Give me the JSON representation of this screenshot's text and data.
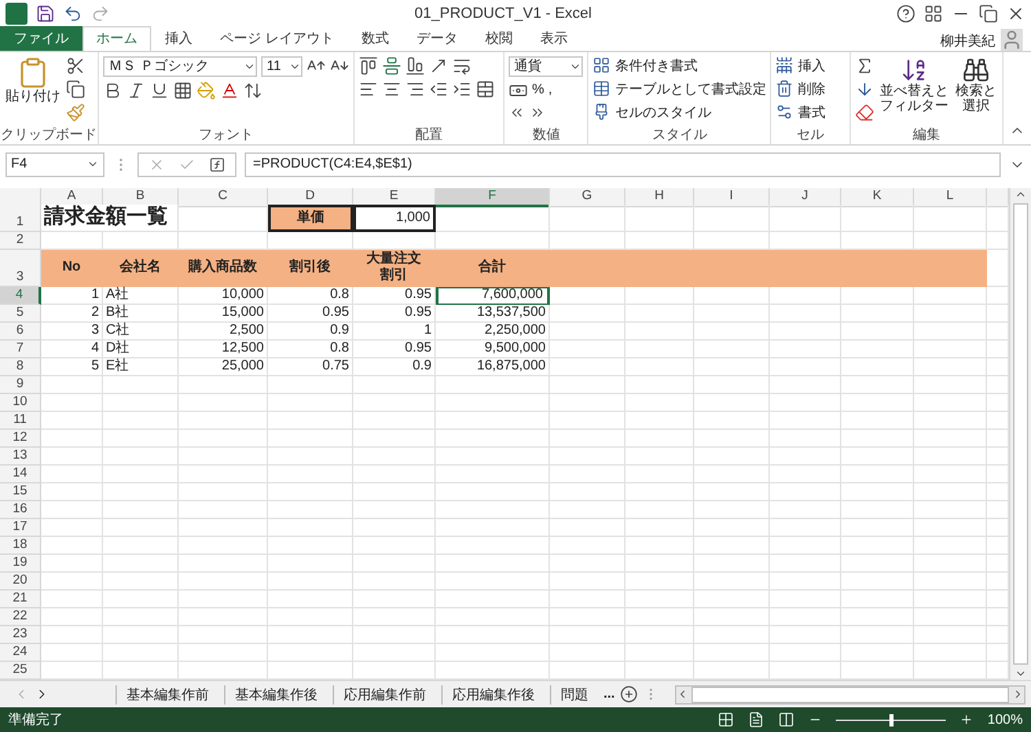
{
  "title_bar": {
    "title": "01_PRODUCT_V1 - Excel",
    "user": "柳井美紀"
  },
  "tabs": [
    {
      "label": "ファイル",
      "kind": "file",
      "selected": false
    },
    {
      "label": "ホーム",
      "kind": "tab",
      "selected": true
    },
    {
      "label": "挿入",
      "kind": "tab",
      "selected": false
    },
    {
      "label": "ページ レイアウト",
      "kind": "tab",
      "selected": false
    },
    {
      "label": "数式",
      "kind": "tab",
      "selected": false
    },
    {
      "label": "データ",
      "kind": "tab",
      "selected": false
    },
    {
      "label": "校閲",
      "kind": "tab",
      "selected": false
    },
    {
      "label": "表示",
      "kind": "tab",
      "selected": false
    }
  ],
  "ribbon": {
    "clipboard": {
      "label": "クリップボード",
      "paste": "貼り付け"
    },
    "font": {
      "label": "フォント",
      "name": "ＭＳ Ｐゴシック",
      "size": "11"
    },
    "alignment": {
      "label": "配置"
    },
    "number": {
      "label": "数値",
      "format": "通貨",
      "percent": "%",
      "comma": ","
    },
    "styles": {
      "label": "スタイル",
      "items": [
        "条件付き書式",
        "テーブルとして書式設定",
        "セルのスタイル"
      ]
    },
    "cells": {
      "label": "セル",
      "items": [
        "挿入",
        "削除",
        "書式"
      ]
    },
    "editing": {
      "label": "編集",
      "sort": "並べ替えとフィルター",
      "find": "検索と選択"
    }
  },
  "formula_bar": {
    "name_box": "F4",
    "formula": "=PRODUCT(C4:E4,$E$1)"
  },
  "sheet": {
    "columns": [
      {
        "label": "A",
        "selected": false
      },
      {
        "label": "B",
        "selected": false
      },
      {
        "label": "C",
        "selected": false
      },
      {
        "label": "D",
        "selected": false
      },
      {
        "label": "E",
        "selected": false
      },
      {
        "label": "F",
        "selected": true
      },
      {
        "label": "G",
        "selected": false
      },
      {
        "label": "H",
        "selected": false
      },
      {
        "label": "I",
        "selected": false
      },
      {
        "label": "J",
        "selected": false
      },
      {
        "label": "K",
        "selected": false
      },
      {
        "label": "L",
        "selected": false
      }
    ],
    "rows": [
      {
        "header": "1",
        "kind": "title",
        "selected": false,
        "cells": [
          "請求金額一覧",
          "",
          "",
          "単価",
          "1,000",
          ""
        ]
      },
      {
        "header": "2",
        "kind": "blank",
        "selected": false
      },
      {
        "header": "3",
        "kind": "header",
        "selected": false,
        "cells": [
          "No",
          "会社名",
          "購入商品数",
          "割引後",
          "大量注文割引",
          "合計"
        ]
      },
      {
        "header": "4",
        "kind": "data",
        "selected": true,
        "cells": [
          "1",
          "A社",
          "10,000",
          "0.8",
          "0.95",
          "7,600,000"
        ]
      },
      {
        "header": "5",
        "kind": "data",
        "selected": false,
        "cells": [
          "2",
          "B社",
          "15,000",
          "0.95",
          "0.95",
          "13,537,500"
        ]
      },
      {
        "header": "6",
        "kind": "data",
        "selected": false,
        "cells": [
          "3",
          "C社",
          "2,500",
          "0.9",
          "1",
          "2,250,000"
        ]
      },
      {
        "header": "7",
        "kind": "data",
        "selected": false,
        "cells": [
          "4",
          "D社",
          "12,500",
          "0.8",
          "0.95",
          "9,500,000"
        ]
      },
      {
        "header": "8",
        "kind": "data",
        "selected": false,
        "cells": [
          "5",
          "E社",
          "25,000",
          "0.75",
          "0.9",
          "16,875,000"
        ]
      },
      {
        "header": "9",
        "kind": "blank",
        "selected": false
      },
      {
        "header": "10",
        "kind": "blank",
        "selected": false
      },
      {
        "header": "11",
        "kind": "blank",
        "selected": false
      },
      {
        "header": "12",
        "kind": "blank",
        "selected": false
      },
      {
        "header": "13",
        "kind": "blank",
        "selected": false
      },
      {
        "header": "14",
        "kind": "blank",
        "selected": false
      },
      {
        "header": "15",
        "kind": "blank",
        "selected": false
      },
      {
        "header": "16",
        "kind": "blank",
        "selected": false
      },
      {
        "header": "17",
        "kind": "blank",
        "selected": false
      },
      {
        "header": "18",
        "kind": "blank",
        "selected": false
      },
      {
        "header": "19",
        "kind": "blank",
        "selected": false
      },
      {
        "header": "20",
        "kind": "blank",
        "selected": false
      },
      {
        "header": "21",
        "kind": "blank",
        "selected": false
      },
      {
        "header": "22",
        "kind": "blank",
        "selected": false
      },
      {
        "header": "23",
        "kind": "blank",
        "selected": false
      },
      {
        "header": "24",
        "kind": "blank",
        "selected": false
      },
      {
        "header": "25",
        "kind": "blank",
        "selected": false
      }
    ]
  },
  "sheet_tabs": {
    "tabs": [
      "基本編集作前",
      "基本編集作後",
      "応用編集作前",
      "応用編集作後",
      "問題"
    ],
    "more": "..."
  },
  "status_bar": {
    "text": "準備完了",
    "zoom": "100%",
    "zoom_slider": {
      "level": 0.5
    }
  }
}
